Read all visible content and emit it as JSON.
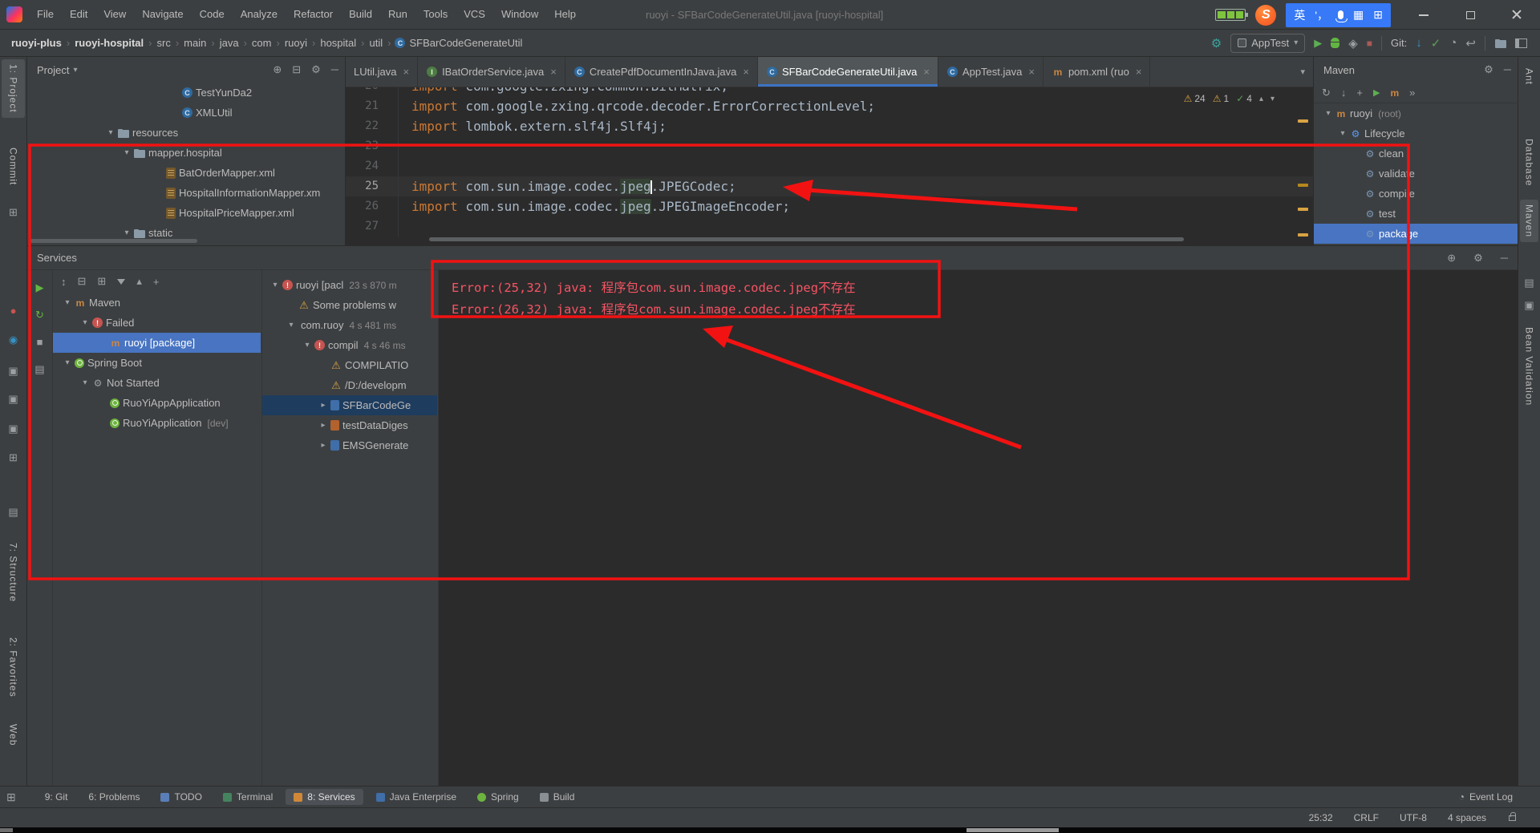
{
  "colors": {
    "annotation_red": "#f21212",
    "selection_blue": "#4874c2",
    "error_red": "#f75464",
    "accent_green": "#499c54"
  },
  "titlebar": {
    "menus": [
      "File",
      "Edit",
      "View",
      "Navigate",
      "Code",
      "Analyze",
      "Refactor",
      "Build",
      "Run",
      "Tools",
      "VCS",
      "Window",
      "Help"
    ],
    "title": "ruoyi - SFBarCodeGenerateUtil.java [ruoyi-hospital]",
    "ime_lang": "英",
    "ime_punct": "'，",
    "sogou_s": "S"
  },
  "navbar": {
    "crumbs": [
      "ruoyi-plus",
      "ruoyi-hospital",
      "src",
      "main",
      "java",
      "com",
      "ruoyi",
      "hospital",
      "util"
    ],
    "file": "SFBarCodeGenerateUtil",
    "run_config": "AppTest",
    "git_label": "Git:"
  },
  "project": {
    "title": "Project",
    "items": [
      {
        "label": "TestYunDa2",
        "icon": "class",
        "indent": 8
      },
      {
        "label": "XMLUtil",
        "icon": "class",
        "indent": 8
      },
      {
        "label": "resources",
        "icon": "folder",
        "indent": 4,
        "chev": "down"
      },
      {
        "label": "mapper.hospital",
        "icon": "folder",
        "indent": 5,
        "chev": "down"
      },
      {
        "label": "BatOrderMapper.xml",
        "icon": "xml",
        "indent": 7
      },
      {
        "label": "HospitalInformationMapper.xm",
        "icon": "xml",
        "indent": 7
      },
      {
        "label": "HospitalPriceMapper.xml",
        "icon": "xml",
        "indent": 7
      },
      {
        "label": "static",
        "icon": "folder",
        "indent": 5,
        "chev": "down"
      }
    ]
  },
  "editor": {
    "tabs": [
      {
        "label": "LUtil.java"
      },
      {
        "label": "IBatOrderService.java",
        "icon": "interface"
      },
      {
        "label": "CreatePdfDocumentInJava.java",
        "icon": "class"
      },
      {
        "label": "SFBarCodeGenerateUtil.java",
        "icon": "class",
        "active": true
      },
      {
        "label": "AppTest.java",
        "icon": "class"
      },
      {
        "label": "pom.xml (ruo",
        "icon": "maven"
      }
    ],
    "inspections": [
      {
        "icon": "warning",
        "count": "24"
      },
      {
        "icon": "warning",
        "count": "1"
      },
      {
        "icon": "check",
        "count": "4"
      }
    ],
    "lines": [
      {
        "no": "20",
        "text": "import com.google.zxing.common.BitMatrix;"
      },
      {
        "no": "21",
        "text": "import com.google.zxing.qrcode.decoder.ErrorCorrectionLevel;"
      },
      {
        "no": "22",
        "text": "import lombok.extern.slf4j.Slf4j;"
      },
      {
        "no": "23",
        "text": ""
      },
      {
        "no": "24",
        "text": ""
      },
      {
        "no": "25",
        "text": "import com.sun.image.codec.jpeg.JPEGCodec;",
        "current": true,
        "hl": "jpeg",
        "caret": true
      },
      {
        "no": "26",
        "text": "import com.sun.image.codec.jpeg.JPEGImageEncoder;",
        "hl": "jpeg"
      },
      {
        "no": "27",
        "text": ""
      }
    ]
  },
  "maven": {
    "title": "Maven",
    "items": [
      {
        "label": "ruoyi",
        "extra": "(root)",
        "icon": "maven",
        "indent": 0,
        "chev": "down"
      },
      {
        "label": "Lifecycle",
        "icon": "lifecycle",
        "indent": 1,
        "chev": "down"
      },
      {
        "label": "clean",
        "icon": "goal",
        "indent": 2
      },
      {
        "label": "validate",
        "icon": "goal",
        "indent": 2
      },
      {
        "label": "compile",
        "icon": "goal",
        "indent": 2
      },
      {
        "label": "test",
        "icon": "goal",
        "indent": 2
      },
      {
        "label": "package",
        "icon": "goal",
        "indent": 2,
        "selected": true
      }
    ]
  },
  "services": {
    "title": "Services",
    "run_tree": [
      {
        "label": "Maven",
        "icon": "maven",
        "indent": 0,
        "chev": "down"
      },
      {
        "label": "Failed",
        "icon": "error",
        "indent": 1,
        "chev": "down"
      },
      {
        "label": "ruoyi [package]",
        "icon": "maven",
        "indent": 2,
        "selected": true
      },
      {
        "label": "Spring Boot",
        "icon": "spring",
        "indent": 0,
        "chev": "down"
      },
      {
        "label": "Not Started",
        "icon": "notstarted",
        "indent": 1,
        "chev": "down"
      },
      {
        "label": "RuoYiAppApplication",
        "icon": "spring",
        "indent": 2
      },
      {
        "label": "RuoYiApplication",
        "extra": "[dev]",
        "icon": "spring",
        "indent": 2
      }
    ],
    "build_tree": [
      {
        "label": "ruoyi [pacl",
        "extra": "23 s 870 m",
        "icon": "error",
        "indent": 0,
        "chev": "down"
      },
      {
        "label": "Some problems w",
        "icon": "warning",
        "indent": 1
      },
      {
        "label": "com.ruoy",
        "extra": "4 s 481 ms",
        "indent": 1,
        "chev": "down"
      },
      {
        "label": "compil",
        "extra": "4 s 46 ms",
        "icon": "error",
        "indent": 2,
        "chev": "down"
      },
      {
        "label": "COMPILATIO",
        "icon": "warning",
        "indent": 3
      },
      {
        "label": "/D:/developm",
        "icon": "warning",
        "indent": 3
      },
      {
        "label": "SFBarCodeGe",
        "icon": "file-blue",
        "indent": 3,
        "chev": "right",
        "selected_dark": true
      },
      {
        "label": "testDataDiges",
        "icon": "file-orange",
        "indent": 3,
        "chev": "right"
      },
      {
        "label": "EMSGenerate",
        "icon": "file-blue",
        "indent": 3,
        "chev": "right"
      }
    ],
    "console": [
      "Error:(25,32) java: 程序包com.sun.image.codec.jpeg不存在",
      "Error:(26,32) java: 程序包com.sun.image.codec.jpeg不存在"
    ]
  },
  "toolwindows": {
    "items": [
      {
        "label": "9: Git"
      },
      {
        "label": "6: Problems"
      },
      {
        "label": "TODO",
        "icon": "todo"
      },
      {
        "label": "Terminal",
        "icon": "terminal"
      },
      {
        "label": "8: Services",
        "icon": "services",
        "active": true
      },
      {
        "label": "Java Enterprise",
        "icon": "java"
      },
      {
        "label": "Spring",
        "icon": "spring"
      },
      {
        "label": "Build",
        "icon": "build"
      }
    ],
    "event_log": "Event Log"
  },
  "statusbar": {
    "position": "25:32",
    "line_ending": "CRLF",
    "encoding": "UTF-8",
    "indent": "4 spaces"
  },
  "stripes": {
    "left": {
      "project": "1: Project",
      "commit": "Commit",
      "structure": "7: Structure",
      "favorites": "2: Favorites",
      "web": "Web"
    },
    "right": {
      "ant": "Ant",
      "database": "Database",
      "maven": "Maven",
      "bean": "Bean Validation"
    }
  },
  "icons": {
    "chevron_down": "▾",
    "chevron_right": "▸",
    "gear": "⚙",
    "warning": "⚠",
    "check": "✓",
    "play": "▶",
    "plus": "+",
    "minus": "─",
    "refresh": "↻",
    "undo": "↩",
    "down": "↓",
    "clock": "◔",
    "globe": "⊕",
    "collapse": "⊟",
    "sort": "↕",
    "grid": "⊞",
    "keyboard": "▦",
    "list": "▤",
    "up": "▴",
    "dot": "●",
    "square": "▣",
    "circle": "◉",
    "excl": "!",
    "maven_m": "m",
    "close": "×",
    "crumb_sep": "›",
    "more": "»",
    "shield": "◈"
  }
}
